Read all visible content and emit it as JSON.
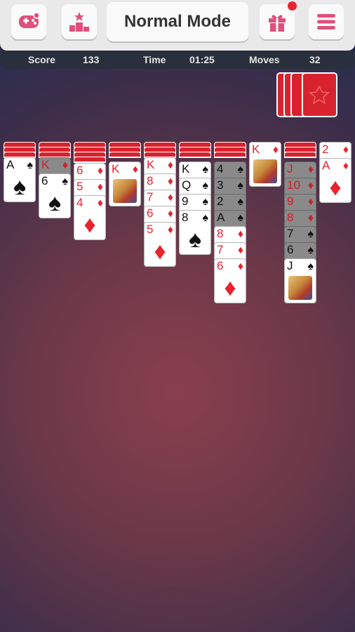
{
  "header": {
    "mode_title": "Normal Mode",
    "icons": [
      "gamepad-icon",
      "leaderboard-icon",
      "gift-icon",
      "menu-icon"
    ],
    "gift_badge": true
  },
  "stats": {
    "score_label": "Score",
    "score": "133",
    "time_label": "Time",
    "time": "01:25",
    "moves_label": "Moves",
    "moves": "32"
  },
  "colors": {
    "card_back": "#d8232f",
    "red_suit": "#e8232f",
    "black_suit": "#111111",
    "accent": "#e0507a"
  },
  "stock": {
    "face_down_piles": 4
  },
  "tableau": [
    {
      "hidden": 3,
      "cards": [
        {
          "rank": "A",
          "suit": "♠",
          "face": false
        }
      ]
    },
    {
      "hidden": 3,
      "cards": [
        {
          "rank": "K",
          "suit": "♦",
          "face": true
        },
        {
          "rank": "6",
          "suit": "♠",
          "face": false
        }
      ]
    },
    {
      "hidden": 4,
      "cards": [
        {
          "rank": "6",
          "suit": "♦",
          "face": false
        },
        {
          "rank": "5",
          "suit": "♦",
          "face": false
        },
        {
          "rank": "4",
          "suit": "♦",
          "face": false
        }
      ]
    },
    {
      "hidden": 3,
      "cards": [
        {
          "rank": "K",
          "suit": "♦",
          "face": true
        }
      ]
    },
    {
      "hidden": 3,
      "cards": [
        {
          "rank": "K",
          "suit": "♦",
          "face": true
        },
        {
          "rank": "8",
          "suit": "♦",
          "face": false
        },
        {
          "rank": "7",
          "suit": "♦",
          "face": false
        },
        {
          "rank": "6",
          "suit": "♦",
          "face": false
        },
        {
          "rank": "5",
          "suit": "♦",
          "face": false
        }
      ]
    },
    {
      "hidden": 3,
      "cards": [
        {
          "rank": "K",
          "suit": "♠",
          "face": true
        },
        {
          "rank": "Q",
          "suit": "♠",
          "face": true
        },
        {
          "rank": "9",
          "suit": "♠",
          "face": false
        },
        {
          "rank": "8",
          "suit": "♠",
          "face": false
        }
      ]
    },
    {
      "hidden": 3,
      "cards": [
        {
          "rank": "4",
          "suit": "♠",
          "face": false
        },
        {
          "rank": "3",
          "suit": "♠",
          "face": false
        },
        {
          "rank": "2",
          "suit": "♠",
          "face": false
        },
        {
          "rank": "A",
          "suit": "♠",
          "face": false
        },
        {
          "rank": "8",
          "suit": "♦",
          "face": false
        },
        {
          "rank": "7",
          "suit": "♦",
          "face": false
        },
        {
          "rank": "6",
          "suit": "♦",
          "face": false
        }
      ]
    },
    {
      "hidden": 0,
      "cards": [
        {
          "rank": "K",
          "suit": "♦",
          "face": true
        }
      ]
    },
    {
      "hidden": 3,
      "cards": [
        {
          "rank": "J",
          "suit": "♦",
          "face": true
        },
        {
          "rank": "10",
          "suit": "♦",
          "face": false
        },
        {
          "rank": "9",
          "suit": "♦",
          "face": false
        },
        {
          "rank": "8",
          "suit": "♦",
          "face": false
        },
        {
          "rank": "7",
          "suit": "♠",
          "face": false
        },
        {
          "rank": "6",
          "suit": "♠",
          "face": false
        },
        {
          "rank": "J",
          "suit": "♠",
          "face": true
        }
      ]
    },
    {
      "hidden": 0,
      "cards": [
        {
          "rank": "2",
          "suit": "♦",
          "face": false
        },
        {
          "rank": "A",
          "suit": "♦",
          "face": false
        }
      ]
    }
  ]
}
